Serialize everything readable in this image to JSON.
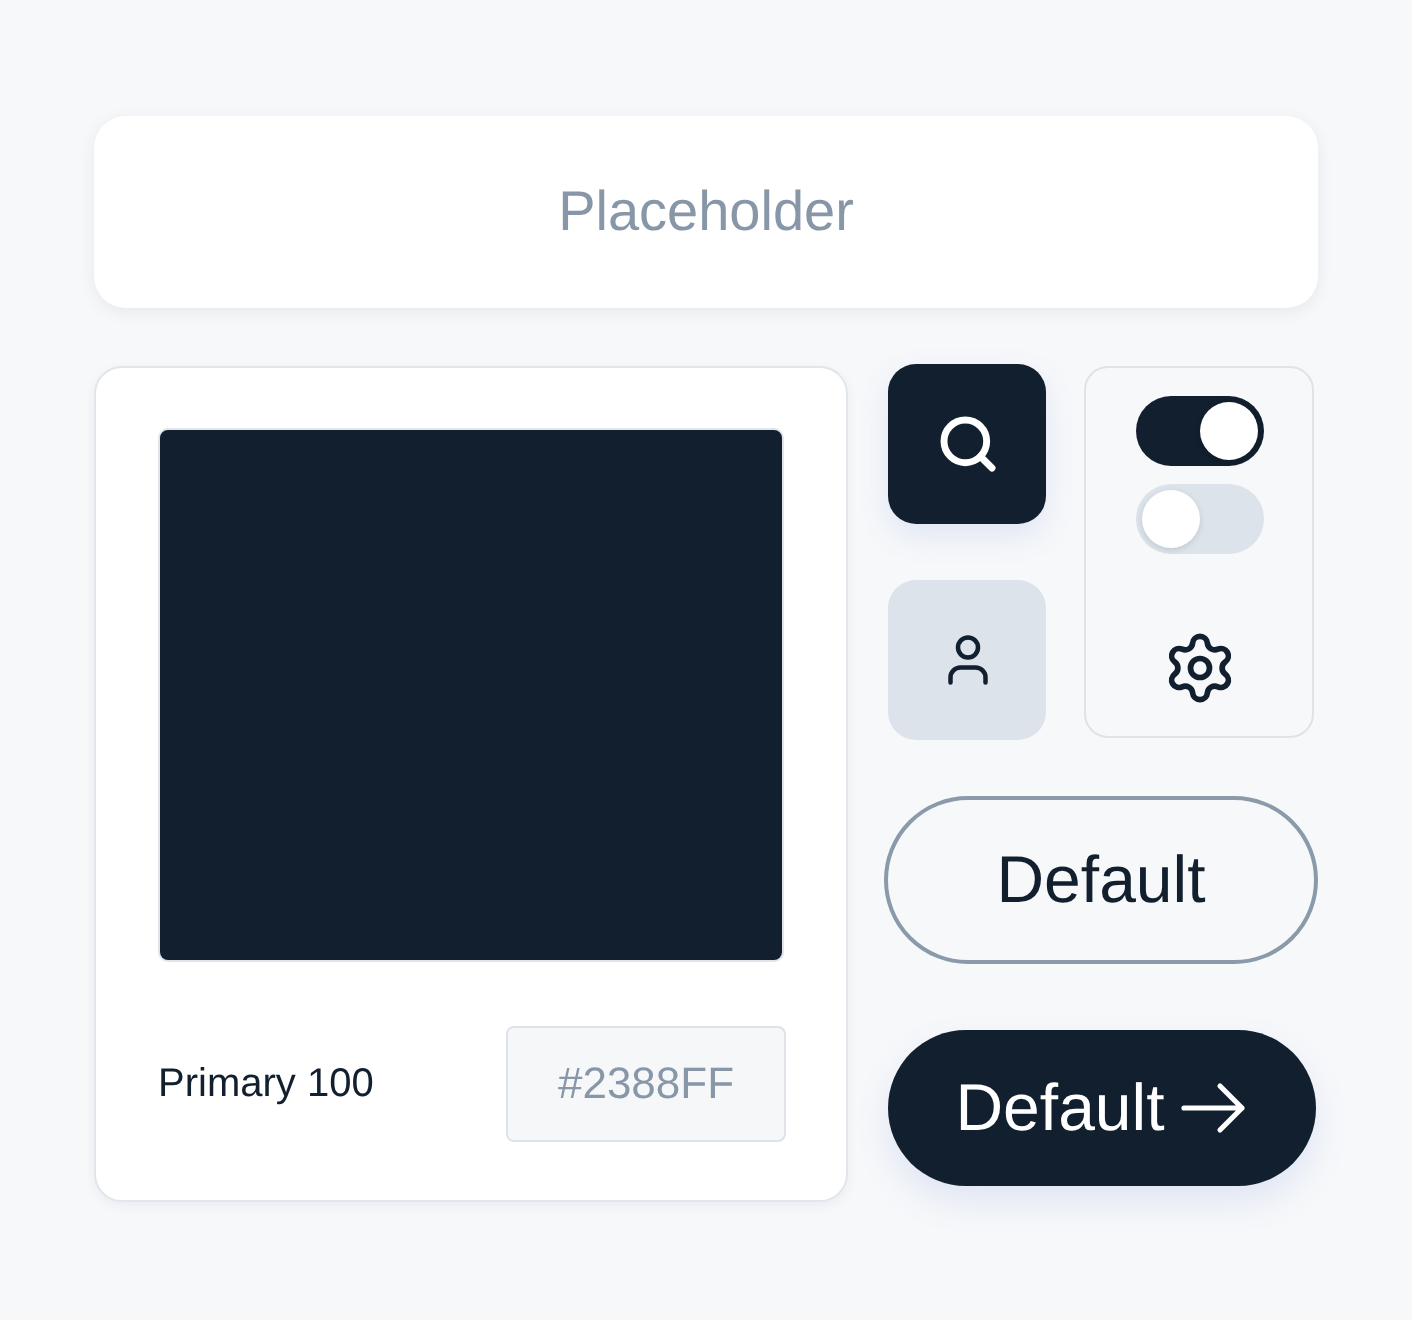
{
  "input": {
    "placeholder": "Placeholder"
  },
  "color_card": {
    "color": "#111f2e",
    "label": "Primary 100",
    "hex_field": {
      "placeholder": "#2388FF"
    }
  },
  "icon_buttons": [
    {
      "kind": "search",
      "selected": true
    },
    {
      "kind": "user",
      "selected": false
    }
  ],
  "toggles": [
    {
      "on": true
    },
    {
      "on": false
    }
  ],
  "buttons": [
    {
      "label": "Default",
      "kind": "outline"
    },
    {
      "label": "Default",
      "kind": "filled"
    }
  ]
}
